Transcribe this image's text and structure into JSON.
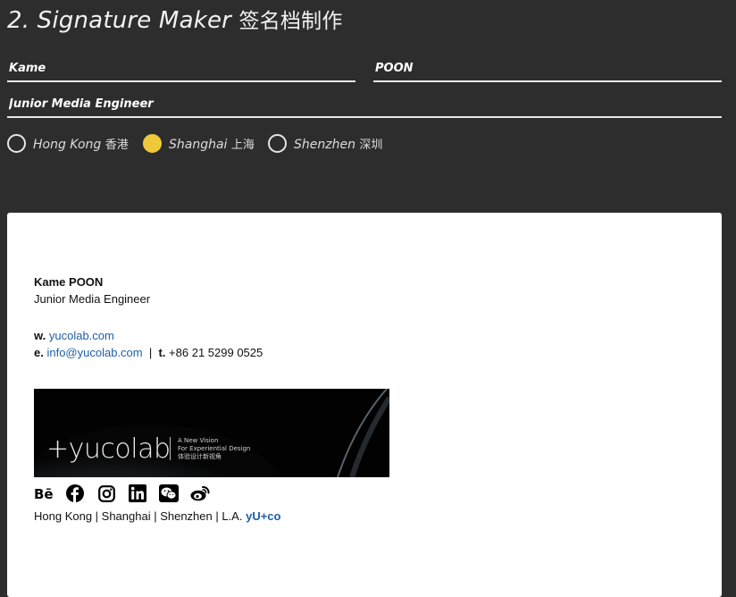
{
  "title": {
    "main": "2. Signature Maker",
    "cn": "签名档制作"
  },
  "form": {
    "first_name": "Kame",
    "last_name": "POON",
    "job_title": "Junior Media Engineer"
  },
  "locations": [
    {
      "label": "Hong Kong",
      "cn": "香港",
      "selected": false
    },
    {
      "label": "Shanghai",
      "cn": "上海",
      "selected": true
    },
    {
      "label": "Shenzhen",
      "cn": "深圳",
      "selected": false
    }
  ],
  "colors": {
    "accent": "#f0c93a",
    "link": "#1f5fa6",
    "background": "#2d2d2d"
  },
  "signature": {
    "name": "Kame POON",
    "job_title": "Junior Media Engineer",
    "web_prefix": "w.",
    "web": "yucolab.com",
    "email_prefix": "e.",
    "email": "info@yucolab.com",
    "sep": "|",
    "tel_prefix": "t.",
    "tel": "+86 21 5299 0525",
    "banner": {
      "logo": "+yucolab",
      "tagline1": "A New Vision",
      "tagline2": "For Experiential Design",
      "tagline3": "体验设计新视角"
    },
    "social_icons": [
      "behance-icon",
      "facebook-icon",
      "instagram-icon",
      "linkedin-icon",
      "wechat-icon",
      "weibo-icon"
    ],
    "footer_cities": "Hong Kong | Shanghai | Shenzhen | L.A.",
    "footer_brand": "yU+co"
  }
}
